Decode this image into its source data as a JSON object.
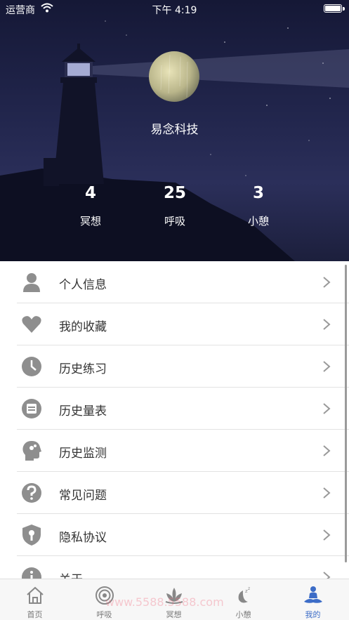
{
  "status_bar": {
    "carrier": "运营商",
    "time": "下午 4:19"
  },
  "profile": {
    "name": "易念科技"
  },
  "stats": [
    {
      "value": "4",
      "label": "冥想"
    },
    {
      "value": "25",
      "label": "呼吸"
    },
    {
      "value": "3",
      "label": "小憩"
    }
  ],
  "menu": [
    {
      "label": "个人信息",
      "icon": "person-icon"
    },
    {
      "label": "我的收藏",
      "icon": "heart-icon"
    },
    {
      "label": "历史练习",
      "icon": "clock-icon"
    },
    {
      "label": "历史量表",
      "icon": "scale-sheet-icon"
    },
    {
      "label": "历史监测",
      "icon": "head-brain-icon"
    },
    {
      "label": "常见问题",
      "icon": "question-icon"
    },
    {
      "label": "隐私协议",
      "icon": "shield-icon"
    },
    {
      "label": "关于",
      "icon": "info-icon"
    }
  ],
  "tabs": [
    {
      "label": "首页",
      "icon": "home-icon"
    },
    {
      "label": "呼吸",
      "icon": "breath-rings-icon"
    },
    {
      "label": "冥想",
      "icon": "lotus-icon"
    },
    {
      "label": "小憩",
      "icon": "moon-zzz-icon"
    },
    {
      "label": "我的",
      "icon": "meditator-icon",
      "active": true
    }
  ],
  "watermark": "www.5588.5588.com",
  "colors": {
    "accent": "#3c6cc7",
    "icon_gray": "#8e8e8e",
    "hero_bg": "#22264d"
  }
}
